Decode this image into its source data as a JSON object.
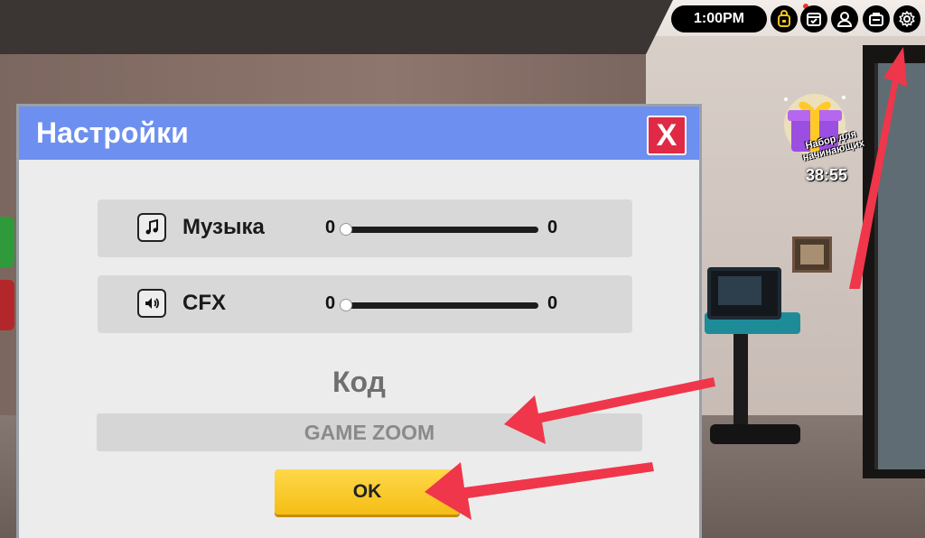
{
  "hud": {
    "time": "1:00PM",
    "icons": [
      "backpack-icon",
      "calendar-icon",
      "user-icon",
      "briefcase-icon",
      "gear-icon"
    ]
  },
  "starter_pack": {
    "label": "Набор для начинающих",
    "timer": "38:55"
  },
  "settings": {
    "title": "Настройки",
    "close_label": "X",
    "music": {
      "label": "Музыка",
      "min": "0",
      "max": "0",
      "level": 0
    },
    "sfx": {
      "label": "CFX",
      "min": "0",
      "max": "0",
      "level": 0
    },
    "code_label": "Код",
    "code_value": "GAME ZOOM",
    "ok_label": "OK"
  },
  "colors": {
    "header": "#6d8ff0",
    "close": "#e02a45",
    "ok": "#f5bd14",
    "arrow": "#f0364a"
  }
}
